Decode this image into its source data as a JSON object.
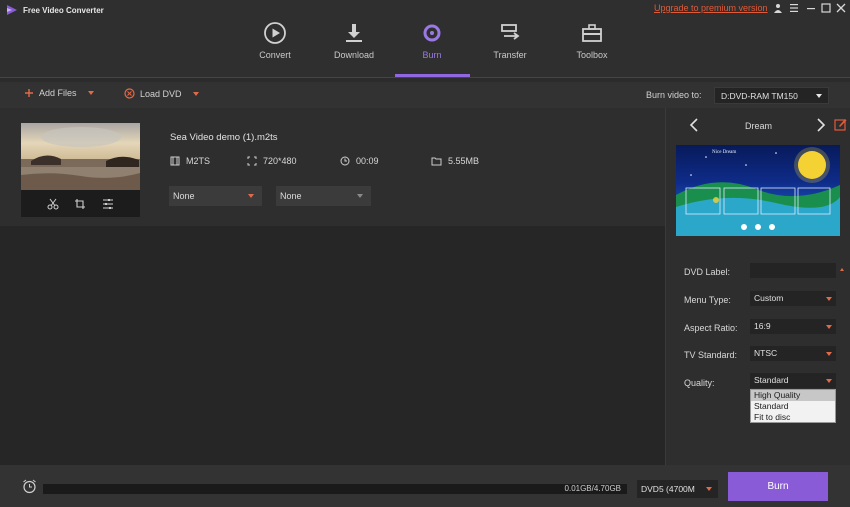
{
  "app": {
    "title": "Free Video Converter",
    "upgrade_link": "Upgrade to premium version"
  },
  "nav": {
    "tabs": [
      {
        "label": "Convert",
        "icon": "play-circle-icon"
      },
      {
        "label": "Download",
        "icon": "download-icon"
      },
      {
        "label": "Burn",
        "icon": "disc-icon",
        "active": true
      },
      {
        "label": "Transfer",
        "icon": "transfer-icon"
      },
      {
        "label": "Toolbox",
        "icon": "toolbox-icon"
      }
    ]
  },
  "toolbar": {
    "add_files": "Add Files",
    "load_dvd": "Load DVD",
    "burn_video_to_label": "Burn video to:",
    "burn_target": "D:DVD-RAM TM150"
  },
  "file": {
    "name": "Sea Video demo (1).m2ts",
    "format": "M2TS",
    "resolution": "720*480",
    "duration": "00:09",
    "size": "5.55MB",
    "subtitle_select": "None",
    "audio_select": "None"
  },
  "right_panel": {
    "template_name": "Dream",
    "preview_title": "Nice Dream",
    "dvd_label": {
      "label": "DVD Label:",
      "value": ""
    },
    "menu_type": {
      "label": "Menu Type:",
      "value": "Custom"
    },
    "aspect_ratio": {
      "label": "Aspect Ratio:",
      "value": "16:9"
    },
    "tv_standard": {
      "label": "TV Standard:",
      "value": "NTSC"
    },
    "quality": {
      "label": "Quality:",
      "value": "Standard",
      "options": [
        "High Quality",
        "Standard",
        "Fit to disc"
      ]
    }
  },
  "bottom": {
    "storage": "0.01GB/4.70GB",
    "disc_type": "DVD5 (4700M",
    "burn_label": "Burn"
  },
  "colors": {
    "accent": "#8a5bd6",
    "highlight": "#e05a3a"
  }
}
